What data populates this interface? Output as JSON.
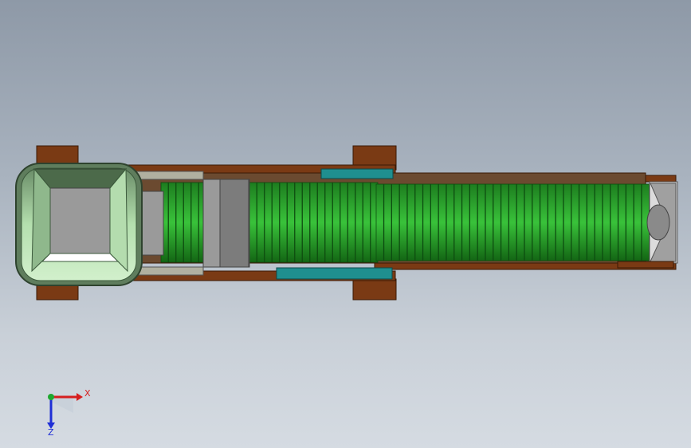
{
  "viewport": {
    "background_top": "#8e99a7",
    "background_bottom": "#d5dbe2"
  },
  "model": {
    "colors": {
      "frame_brown": "#7a3a14",
      "frame_brown_dark": "#4a2208",
      "roller_green": "#2fa82f",
      "roller_green_dark": "#0e5f12",
      "bracket_teal": "#1f8f8f",
      "hopper_green": "#a9d9a0",
      "hopper_outline": "#3c5a3c",
      "plate_gray": "#8a8a8a"
    }
  },
  "triad": {
    "x_label": "X",
    "z_label": "Z",
    "x_color": "#d61f1f",
    "y_color": "#1fa82f",
    "z_color": "#1f2fd6"
  }
}
